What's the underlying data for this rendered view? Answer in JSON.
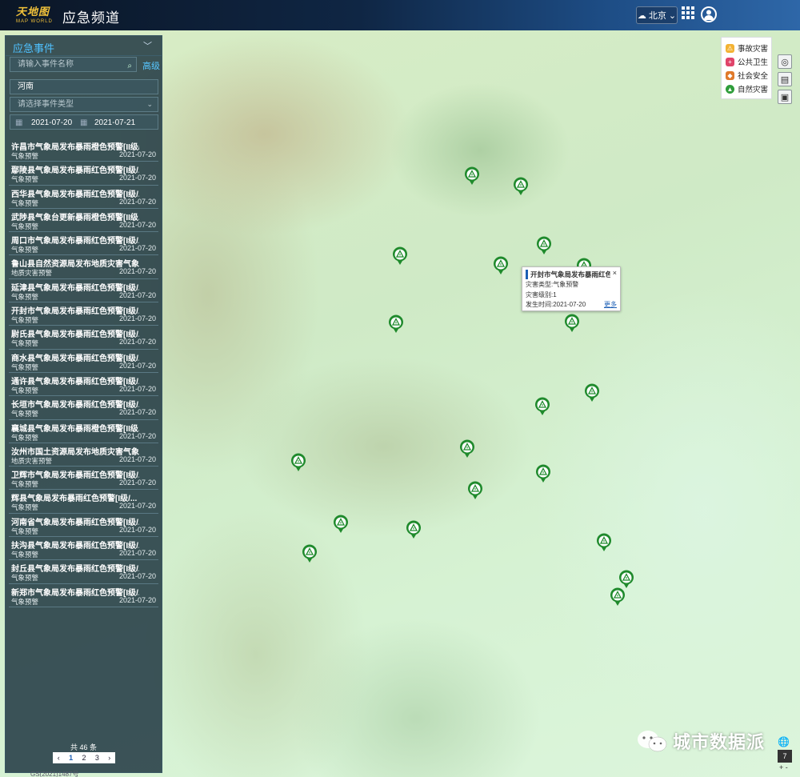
{
  "header": {
    "logo_cn": "天地图",
    "logo_en": "MAP WORLD",
    "title": "应急频道",
    "city": "北京"
  },
  "panel": {
    "title": "应急事件",
    "search_placeholder": "请输入事件名称",
    "advanced_label": "高级",
    "province": "河南",
    "type_placeholder": "请选择事件类型",
    "date_start": "2021-07-20",
    "date_end": "2021-07-21",
    "events": [
      {
        "name": "许昌市气象局发布暴雨橙色预警[II级/...",
        "category": "气象预警",
        "date": "2021-07-20"
      },
      {
        "name": "鄢陵县气象局发布暴雨红色预警[I级/...",
        "category": "气象预警",
        "date": "2021-07-20"
      },
      {
        "name": "西华县气象局发布暴雨红色预警[I级/...",
        "category": "气象预警",
        "date": "2021-07-20"
      },
      {
        "name": "武陟县气象台更新暴雨橙色预警[II级...",
        "category": "气象预警",
        "date": "2021-07-20"
      },
      {
        "name": "周口市气象局发布暴雨红色预警[I级/...",
        "category": "气象预警",
        "date": "2021-07-20"
      },
      {
        "name": "鲁山县自然资源局发布地质灾害气象...",
        "category": "地质灾害预警",
        "date": "2021-07-20"
      },
      {
        "name": "延津县气象局发布暴雨红色预警[I级/...",
        "category": "气象预警",
        "date": "2021-07-20"
      },
      {
        "name": "开封市气象局发布暴雨红色预警[I级/...",
        "category": "气象预警",
        "date": "2021-07-20"
      },
      {
        "name": "尉氏县气象局发布暴雨红色预警[I级/...",
        "category": "气象预警",
        "date": "2021-07-20"
      },
      {
        "name": "商水县气象局发布暴雨红色预警[I级/...",
        "category": "气象预警",
        "date": "2021-07-20"
      },
      {
        "name": "通许县气象局发布暴雨红色预警[I级/...",
        "category": "气象预警",
        "date": "2021-07-20"
      },
      {
        "name": "长垣市气象局发布暴雨红色预警[I级/...",
        "category": "气象预警",
        "date": "2021-07-20"
      },
      {
        "name": "襄城县气象局发布暴雨橙色预警[II级...",
        "category": "气象预警",
        "date": "2021-07-20"
      },
      {
        "name": "汝州市国土资源局发布地质灾害气象...",
        "category": "地质灾害预警",
        "date": "2021-07-20"
      },
      {
        "name": "卫辉市气象局发布暴雨红色预警[I级/...",
        "category": "气象预警",
        "date": "2021-07-20"
      },
      {
        "name": "辉县气象局发布暴雨红色预警[I级/...",
        "category": "气象预警",
        "date": "2021-07-20"
      },
      {
        "name": "河南省气象局发布暴雨红色预警[I级/...",
        "category": "气象预警",
        "date": "2021-07-20"
      },
      {
        "name": "扶沟县气象局发布暴雨红色预警[I级/...",
        "category": "气象预警",
        "date": "2021-07-20"
      },
      {
        "name": "封丘县气象局发布暴雨红色预警[I级/...",
        "category": "气象预警",
        "date": "2021-07-20"
      },
      {
        "name": "新郑市气象局发布暴雨红色预警[I级/...",
        "category": "气象预警",
        "date": "2021-07-20"
      }
    ],
    "total": "共 46 条",
    "pages": [
      "1",
      "2",
      "3"
    ],
    "current_page": "1",
    "copyright": "GS(2021)1487号"
  },
  "legend": {
    "items": [
      {
        "label": "事故灾害",
        "color": "#f3b233",
        "icon": "accident-icon"
      },
      {
        "label": "公共卫生",
        "color": "#e0446a",
        "icon": "health-icon"
      },
      {
        "label": "社会安全",
        "color": "#e07a2b",
        "icon": "shield-icon"
      },
      {
        "label": "自然灾害",
        "color": "#2f9d3b",
        "icon": "nature-icon"
      }
    ]
  },
  "popup": {
    "title": "开封市气象局发布暴雨红色...",
    "type_line": "灾害类型:气象预警",
    "level_line": "灾害级别:1",
    "time_line": "发生时间:2021-07-20",
    "more": "更多",
    "close": "×"
  },
  "map": {
    "zoom_level": "7",
    "marker_color": "#1f8a2c"
  },
  "watermark": "城市数据派"
}
